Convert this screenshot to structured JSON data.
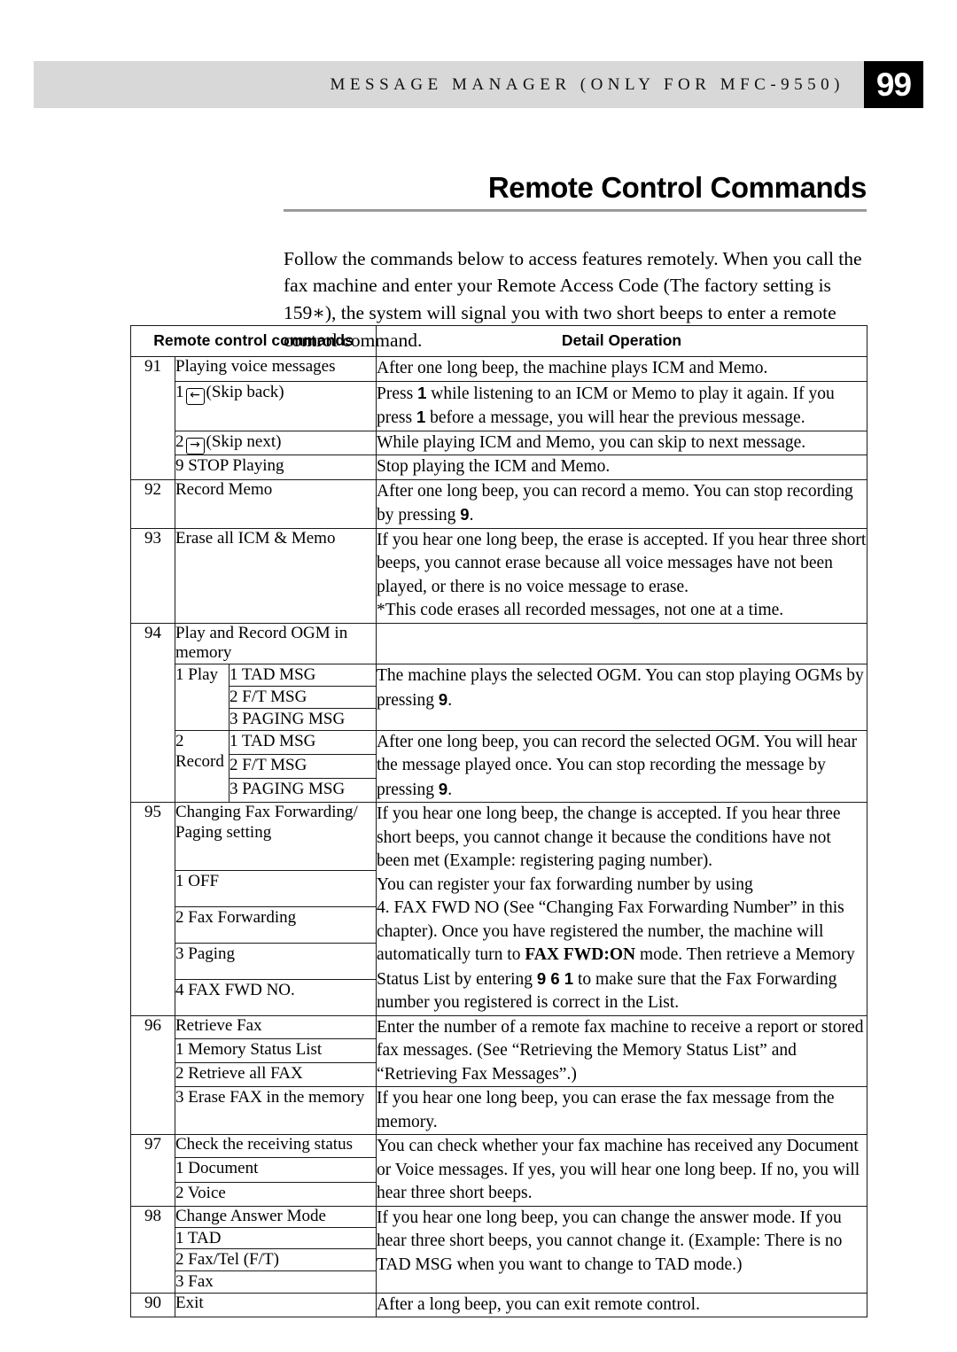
{
  "running_head": {
    "text": "MESSAGE MANAGER (ONLY FOR MFC-9550)",
    "page_number": "99"
  },
  "title": "Remote Control Commands",
  "intro": "Follow the commands below to access features remotely. When you call the fax machine and enter your Remote Access Code (The factory setting is 159∗), the system will signal you with two short beeps to enter a remote control command.",
  "table": {
    "headers": {
      "commands": "Remote control commands",
      "detail": "Detail Operation"
    },
    "rows": {
      "r91": {
        "code": "91",
        "label": "Playing voice messages",
        "detail": "After one long beep, the machine plays ICM and Memo.",
        "sub": {
          "s1_num": "1",
          "s1_icon": "arrow-left-key-icon",
          "s1_label": "(Skip back)",
          "s1_detail_a": "Press ",
          "s1_detail_b": "1",
          "s1_detail_c": " while listening to an ICM or Memo to play it again. If you press ",
          "s1_detail_d": "1",
          "s1_detail_e": " before a message, you will hear the previous message.",
          "s2_num": "2",
          "s2_icon": "arrow-right-key-icon",
          "s2_label": "(Skip next)",
          "s2_detail": "While playing ICM and Memo, you can skip to next message.",
          "s3": "9  STOP Playing",
          "s3_detail": "Stop playing the ICM and Memo."
        }
      },
      "r92": {
        "code": "92",
        "label": "Record  Memo",
        "detail_a": "After one long beep, you can record a memo. You can stop recording by pressing ",
        "detail_b": "9",
        "detail_c": "."
      },
      "r93": {
        "code": "93",
        "label": "Erase all ICM & Memo",
        "detail_line1": "If you hear one long beep, the erase is accepted. If you hear three short beeps, you cannot erase because all voice messages have not been played, or there is no voice message to erase.",
        "detail_line2": "*This code erases all recorded messages, not one at a time."
      },
      "r94": {
        "code": "94",
        "label": "Play and Record OGM in memory",
        "group1": "1  Play",
        "group1_items": [
          "1 TAD MSG",
          "2 F/T MSG",
          "3 PAGING MSG"
        ],
        "group1_detail_a": "The machine plays the selected OGM. You can stop playing OGMs by pressing ",
        "group1_detail_b": "9",
        "group1_detail_c": ".",
        "group2": "2  Record",
        "group2_items": [
          "1 TAD MSG",
          "2 F/T MSG",
          "3 PAGING MSG"
        ],
        "group2_detail_a": "After one long beep, you can record the selected OGM. You will hear the message played once. You can stop recording the message by pressing ",
        "group2_detail_b": "9",
        "group2_detail_c": "."
      },
      "r95": {
        "code": "95",
        "label": "Changing Fax Forwarding/ Paging setting",
        "items": [
          "1  OFF",
          "2  Fax Forwarding",
          "3  Paging",
          "4  FAX FWD NO."
        ],
        "detail_p1": "If you hear one long beep, the change is accepted. If you hear three short beeps, you cannot change it because the conditions have not been met (Example: registering paging number).",
        "detail_p2": "You can register your fax forwarding number by using",
        "detail_p3_a": "4. FAX FWD NO (See “Changing Fax Forwarding Number” in this chapter). Once you have registered the number, the machine will automatically turn to ",
        "detail_p3_b": "FAX FWD:ON",
        "detail_p3_c": " mode. Then retrieve a Memory Status List by entering ",
        "detail_p3_d": "9 6 1",
        "detail_p3_e": " to make sure that the Fax Forwarding number you registered is correct in the List."
      },
      "r96": {
        "code": "96",
        "label": "Retrieve Fax",
        "items": [
          "1  Memory Status List",
          "2  Retrieve all FAX"
        ],
        "detail_top": "Enter the number of a remote fax machine to receive a report or stored fax messages. (See “Retrieving the Memory Status List” and “Retrieving Fax Messages”.)",
        "item3": "3  Erase FAX in the memory",
        "detail_bottom": "If you hear one long beep, you can erase the fax message from the memory."
      },
      "r97": {
        "code": "97",
        "label": "Check the receiving status",
        "items": [
          "1  Document",
          "2  Voice"
        ],
        "detail": "You can check whether your fax machine has received any Document or Voice messages. If yes, you will hear one long beep. If no, you will hear three short beeps."
      },
      "r98": {
        "code": "98",
        "label": "Change Answer Mode",
        "item1": "1  TAD",
        "item2_a": "2  Fax/Tel (",
        "item2_b": "F/T",
        "item2_c": ")",
        "item3": "3  Fax",
        "detail": "If you hear one long beep, you can change the answer mode. If you hear three short beeps, you cannot change it. (Example: There is no TAD MSG when you want to change to TAD mode.)"
      },
      "r90": {
        "code": "90",
        "label": "Exit",
        "detail": "After a long beep, you can exit remote control."
      }
    }
  }
}
